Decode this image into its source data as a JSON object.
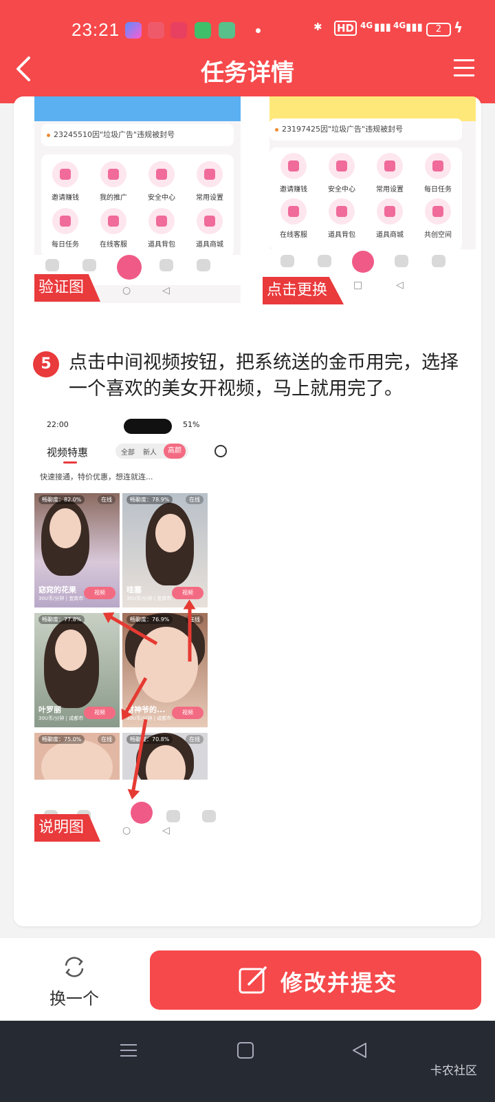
{
  "status_bar": {
    "time": "23:21",
    "network": "HD",
    "signal1": "4G",
    "signal2": "4G",
    "battery": "2"
  },
  "header": {
    "title": "任务详情"
  },
  "shots": {
    "left": {
      "notice": "23245510因\"垃圾广告\"违规被封号",
      "items": [
        "邀请赚钱",
        "我的推广",
        "安全中心",
        "常用设置",
        "每日任务",
        "在线客服",
        "道具背包",
        "道具商城"
      ],
      "tag": "验证图"
    },
    "right": {
      "notice": "23197425因\"垃圾广告\"违规被封号",
      "items": [
        "邀请赚钱",
        "安全中心",
        "常用设置",
        "每日任务",
        "在线客服",
        "道具背包",
        "道具商城",
        "共创空间"
      ],
      "tag": "点击更换"
    }
  },
  "step": {
    "number": "5",
    "text": "点击中间视频按钮，把系统送的金币用完，选择一个喜欢的美女开视频，马上就用完了。"
  },
  "phone": {
    "time": "22:00",
    "battery": "51%",
    "title": "视频特惠",
    "segments": [
      "全部",
      "新人",
      "高颜"
    ],
    "subtitle": "快速接通，特价优惠，想连就连...",
    "cells": [
      {
        "fluency": "畅聊度：82.0%",
        "online": "在线",
        "name": "窈窕的花果",
        "meta": "30U币/分钟 | 宜宾市",
        "btn": "视频"
      },
      {
        "fluency": "畅聊度：78.9%",
        "online": "在线",
        "name": "哇塞",
        "meta": "30U币/分钟 | 宜宾市",
        "btn": "视频"
      },
      {
        "fluency": "畅聊度：77.8%",
        "online": "在线",
        "name": "叶罗丽",
        "meta": "30U币/分钟 | 成都市",
        "btn": "视频"
      },
      {
        "fluency": "畅聊度：76.9%",
        "online": "在线",
        "name": "财神爷的...",
        "meta": "30U币/分钟 | 成都市",
        "btn": "视频"
      },
      {
        "fluency": "畅聊度：75.0%",
        "online": "在线"
      },
      {
        "fluency": "畅聊度：70.8%",
        "online": "在线"
      }
    ],
    "tag": "说明图"
  },
  "actions": {
    "swap_label": "换一个",
    "submit_label": "修改并提交"
  },
  "watermark": "卡农社区",
  "colors": {
    "brand": "#f6494b",
    "tag": "#e93a3c",
    "pink": "#f36b82"
  }
}
